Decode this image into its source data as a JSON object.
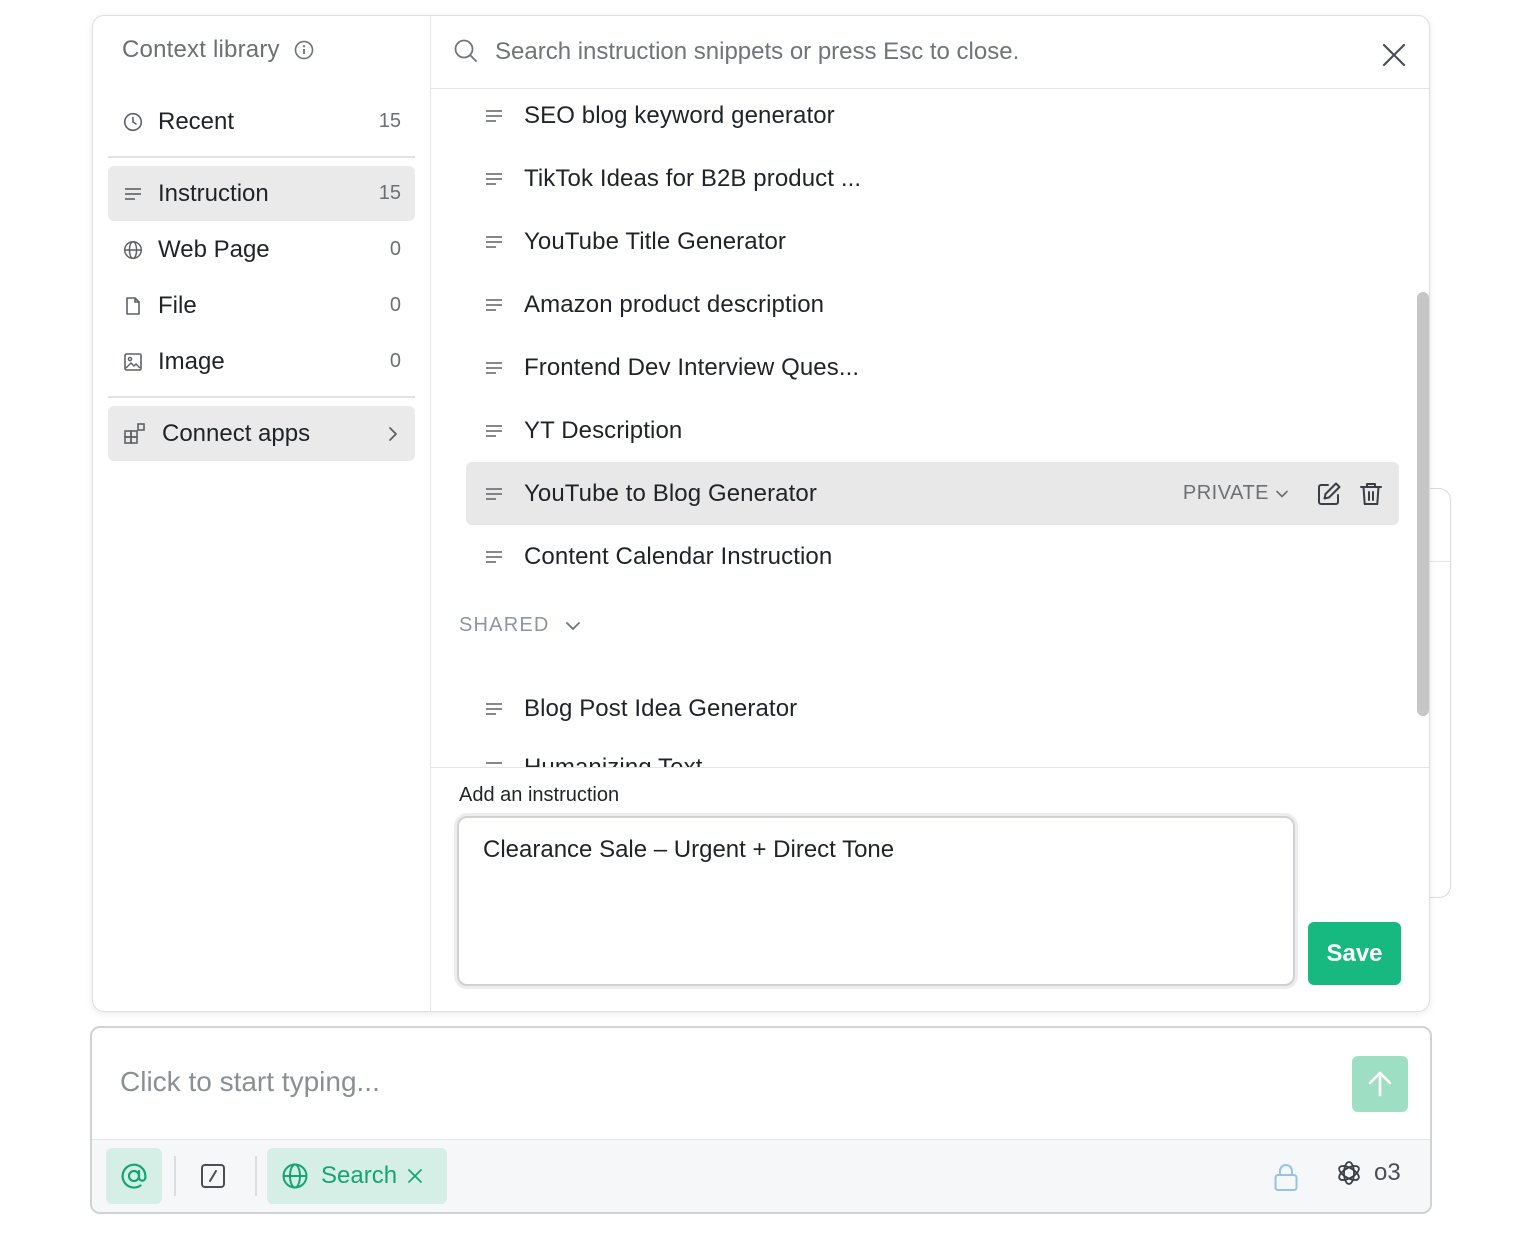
{
  "sidebar": {
    "title": "Context library",
    "items": [
      {
        "label": "Recent",
        "count": "15",
        "icon": "clock-icon"
      },
      {
        "label": "Instruction",
        "count": "15",
        "icon": "lines-icon"
      },
      {
        "label": "Web Page",
        "count": "0",
        "icon": "globe-icon"
      },
      {
        "label": "File",
        "count": "0",
        "icon": "file-icon"
      },
      {
        "label": "Image",
        "count": "0",
        "icon": "image-icon"
      }
    ],
    "connect_label": "Connect apps"
  },
  "search": {
    "placeholder": "Search instruction snippets or press Esc to close."
  },
  "instructions": {
    "items": [
      {
        "label": "SEO blog keyword generator"
      },
      {
        "label": "TikTok Ideas for B2B product ..."
      },
      {
        "label": "YouTube Title Generator"
      },
      {
        "label": "Amazon product description"
      },
      {
        "label": "Frontend Dev Interview Ques..."
      },
      {
        "label": "YT Description"
      },
      {
        "label": "YouTube to Blog Generator",
        "visibility": "PRIVATE"
      },
      {
        "label": "Content Calendar Instruction"
      }
    ],
    "shared_label": "SHARED",
    "shared_items": [
      {
        "label": "Blog Post Idea Generator"
      },
      {
        "label": "Humanizing Text"
      }
    ]
  },
  "add_instruction": {
    "label": "Add an instruction",
    "value": "Clearance Sale – Urgent + Direct Tone",
    "save_label": "Save"
  },
  "composer": {
    "placeholder": "Click to start typing...",
    "search_chip": "Search",
    "model": "o3"
  },
  "colors": {
    "accent": "#18b981",
    "accent_light": "#d5efe6",
    "send_disabled": "#9edec3",
    "active_item": "#eaeaea"
  }
}
